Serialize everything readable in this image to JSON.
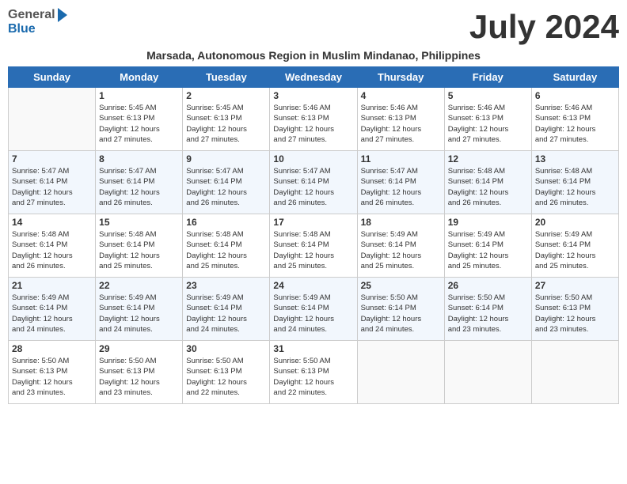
{
  "header": {
    "logo_general": "General",
    "logo_blue": "Blue",
    "month_title": "July 2024",
    "subtitle": "Marsada, Autonomous Region in Muslim Mindanao, Philippines"
  },
  "days_of_week": [
    "Sunday",
    "Monday",
    "Tuesday",
    "Wednesday",
    "Thursday",
    "Friday",
    "Saturday"
  ],
  "weeks": [
    [
      {
        "day": "",
        "text": ""
      },
      {
        "day": "1",
        "text": "Sunrise: 5:45 AM\nSunset: 6:13 PM\nDaylight: 12 hours\nand 27 minutes."
      },
      {
        "day": "2",
        "text": "Sunrise: 5:45 AM\nSunset: 6:13 PM\nDaylight: 12 hours\nand 27 minutes."
      },
      {
        "day": "3",
        "text": "Sunrise: 5:46 AM\nSunset: 6:13 PM\nDaylight: 12 hours\nand 27 minutes."
      },
      {
        "day": "4",
        "text": "Sunrise: 5:46 AM\nSunset: 6:13 PM\nDaylight: 12 hours\nand 27 minutes."
      },
      {
        "day": "5",
        "text": "Sunrise: 5:46 AM\nSunset: 6:13 PM\nDaylight: 12 hours\nand 27 minutes."
      },
      {
        "day": "6",
        "text": "Sunrise: 5:46 AM\nSunset: 6:13 PM\nDaylight: 12 hours\nand 27 minutes."
      }
    ],
    [
      {
        "day": "7",
        "text": "Sunrise: 5:47 AM\nSunset: 6:14 PM\nDaylight: 12 hours\nand 27 minutes."
      },
      {
        "day": "8",
        "text": "Sunrise: 5:47 AM\nSunset: 6:14 PM\nDaylight: 12 hours\nand 26 minutes."
      },
      {
        "day": "9",
        "text": "Sunrise: 5:47 AM\nSunset: 6:14 PM\nDaylight: 12 hours\nand 26 minutes."
      },
      {
        "day": "10",
        "text": "Sunrise: 5:47 AM\nSunset: 6:14 PM\nDaylight: 12 hours\nand 26 minutes."
      },
      {
        "day": "11",
        "text": "Sunrise: 5:47 AM\nSunset: 6:14 PM\nDaylight: 12 hours\nand 26 minutes."
      },
      {
        "day": "12",
        "text": "Sunrise: 5:48 AM\nSunset: 6:14 PM\nDaylight: 12 hours\nand 26 minutes."
      },
      {
        "day": "13",
        "text": "Sunrise: 5:48 AM\nSunset: 6:14 PM\nDaylight: 12 hours\nand 26 minutes."
      }
    ],
    [
      {
        "day": "14",
        "text": "Sunrise: 5:48 AM\nSunset: 6:14 PM\nDaylight: 12 hours\nand 26 minutes."
      },
      {
        "day": "15",
        "text": "Sunrise: 5:48 AM\nSunset: 6:14 PM\nDaylight: 12 hours\nand 25 minutes."
      },
      {
        "day": "16",
        "text": "Sunrise: 5:48 AM\nSunset: 6:14 PM\nDaylight: 12 hours\nand 25 minutes."
      },
      {
        "day": "17",
        "text": "Sunrise: 5:48 AM\nSunset: 6:14 PM\nDaylight: 12 hours\nand 25 minutes."
      },
      {
        "day": "18",
        "text": "Sunrise: 5:49 AM\nSunset: 6:14 PM\nDaylight: 12 hours\nand 25 minutes."
      },
      {
        "day": "19",
        "text": "Sunrise: 5:49 AM\nSunset: 6:14 PM\nDaylight: 12 hours\nand 25 minutes."
      },
      {
        "day": "20",
        "text": "Sunrise: 5:49 AM\nSunset: 6:14 PM\nDaylight: 12 hours\nand 25 minutes."
      }
    ],
    [
      {
        "day": "21",
        "text": "Sunrise: 5:49 AM\nSunset: 6:14 PM\nDaylight: 12 hours\nand 24 minutes."
      },
      {
        "day": "22",
        "text": "Sunrise: 5:49 AM\nSunset: 6:14 PM\nDaylight: 12 hours\nand 24 minutes."
      },
      {
        "day": "23",
        "text": "Sunrise: 5:49 AM\nSunset: 6:14 PM\nDaylight: 12 hours\nand 24 minutes."
      },
      {
        "day": "24",
        "text": "Sunrise: 5:49 AM\nSunset: 6:14 PM\nDaylight: 12 hours\nand 24 minutes."
      },
      {
        "day": "25",
        "text": "Sunrise: 5:50 AM\nSunset: 6:14 PM\nDaylight: 12 hours\nand 24 minutes."
      },
      {
        "day": "26",
        "text": "Sunrise: 5:50 AM\nSunset: 6:14 PM\nDaylight: 12 hours\nand 23 minutes."
      },
      {
        "day": "27",
        "text": "Sunrise: 5:50 AM\nSunset: 6:13 PM\nDaylight: 12 hours\nand 23 minutes."
      }
    ],
    [
      {
        "day": "28",
        "text": "Sunrise: 5:50 AM\nSunset: 6:13 PM\nDaylight: 12 hours\nand 23 minutes."
      },
      {
        "day": "29",
        "text": "Sunrise: 5:50 AM\nSunset: 6:13 PM\nDaylight: 12 hours\nand 23 minutes."
      },
      {
        "day": "30",
        "text": "Sunrise: 5:50 AM\nSunset: 6:13 PM\nDaylight: 12 hours\nand 22 minutes."
      },
      {
        "day": "31",
        "text": "Sunrise: 5:50 AM\nSunset: 6:13 PM\nDaylight: 12 hours\nand 22 minutes."
      },
      {
        "day": "",
        "text": ""
      },
      {
        "day": "",
        "text": ""
      },
      {
        "day": "",
        "text": ""
      }
    ]
  ]
}
